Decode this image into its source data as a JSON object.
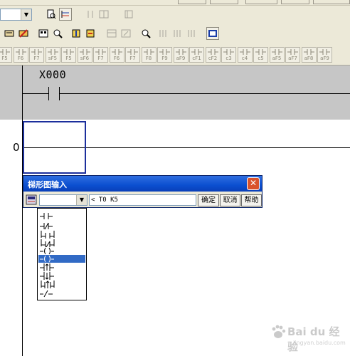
{
  "ladder": {
    "rung0_contact": "X000",
    "rung1_step": "0"
  },
  "dialog": {
    "title": "梯形图输入",
    "close_glyph": "✕",
    "input_value": "< T0 K5",
    "ok_label": "确定",
    "cancel_label": "取消",
    "help_label": "帮助",
    "selected_symbol": "coil"
  },
  "dropdown": {
    "items": [
      "normally-open-contact",
      "normally-closed-contact",
      "parallel-open-contact",
      "parallel-closed-contact",
      "coil",
      "rising-edge-pulse",
      "falling-edge-pulse",
      "parallel-pulse",
      "horizontal-line"
    ]
  },
  "function_keys": {
    "labels": [
      "F5",
      "F6",
      "F7",
      "sF5",
      "F5",
      "sF6",
      "F7",
      "F6",
      "F7",
      "F8",
      "F9",
      "aF9",
      "cF1",
      "cF2",
      "c3",
      "c4",
      "c5",
      "aF5",
      "aF7",
      "aF8",
      "aF9"
    ]
  },
  "watermark": {
    "text": "Bai du 经验",
    "sub": "jingyan.baidu.com"
  }
}
